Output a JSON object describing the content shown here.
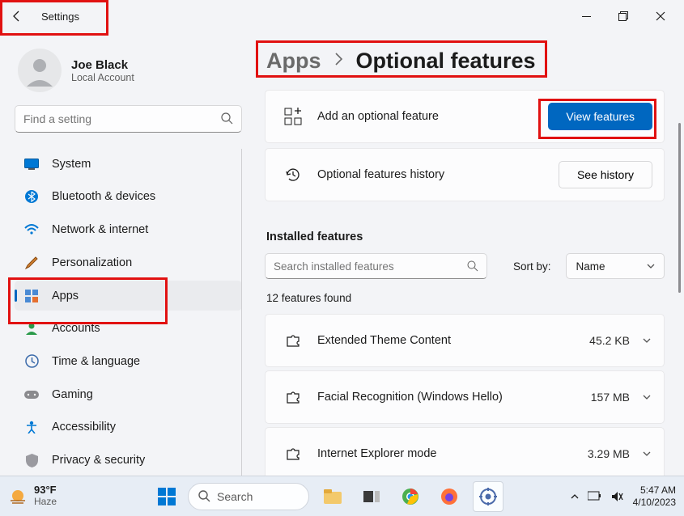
{
  "titlebar": {
    "title": "Settings"
  },
  "account": {
    "name": "Joe Black",
    "sub": "Local Account"
  },
  "search": {
    "placeholder": "Find a setting"
  },
  "nav": {
    "items": [
      {
        "label": "System"
      },
      {
        "label": "Bluetooth & devices"
      },
      {
        "label": "Network & internet"
      },
      {
        "label": "Personalization"
      },
      {
        "label": "Apps"
      },
      {
        "label": "Accounts"
      },
      {
        "label": "Time & language"
      },
      {
        "label": "Gaming"
      },
      {
        "label": "Accessibility"
      },
      {
        "label": "Privacy & security"
      }
    ]
  },
  "breadcrumb": {
    "parent": "Apps",
    "current": "Optional features"
  },
  "cards": {
    "add": {
      "label": "Add an optional feature",
      "button": "View features"
    },
    "history": {
      "label": "Optional features history",
      "button": "See history"
    }
  },
  "installed": {
    "heading": "Installed features",
    "search_placeholder": "Search installed features",
    "sort_label": "Sort by:",
    "sort_value": "Name",
    "count": "12 features found",
    "items": [
      {
        "label": "Extended Theme Content",
        "size": "45.2 KB"
      },
      {
        "label": "Facial Recognition (Windows Hello)",
        "size": "157 MB"
      },
      {
        "label": "Internet Explorer mode",
        "size": "3.29 MB"
      }
    ]
  },
  "taskbar": {
    "temp": "93°F",
    "cond": "Haze",
    "search": "Search",
    "time": "5:47 AM",
    "date": "4/10/2023"
  }
}
